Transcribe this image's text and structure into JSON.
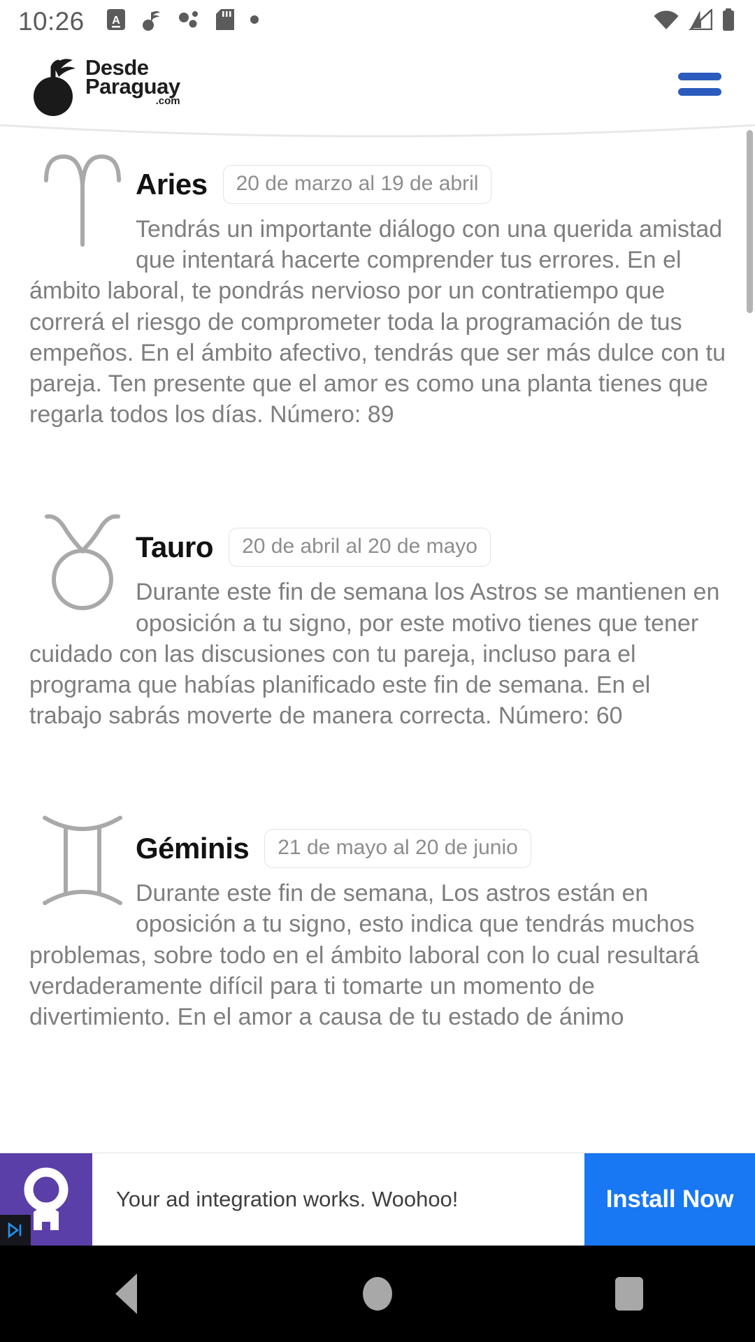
{
  "statusbar": {
    "time": "10:26",
    "left_icons": [
      "caps-lock-a-icon",
      "music-note-icon",
      "bluetooth-dots-icon",
      "sd-card-icon",
      "dot-icon"
    ],
    "right_icons": [
      "wifi-icon",
      "cellular-signal-icon",
      "battery-icon"
    ]
  },
  "header": {
    "logo_line1": "Desde",
    "logo_line2": "Paraguay",
    "logo_line3": ".com",
    "menu_icon": "hamburger-menu-icon",
    "menu_color": "#2a5bbd"
  },
  "signs": [
    {
      "glyph": "aries-ram-icon",
      "name": "Aries",
      "dates": "20 de marzo al 19 de abril",
      "text": "Tendrás un importante diálogo con una querida amistad que intentará hacerte comprender tus errores. En el ámbito laboral, te pondrás nervioso por un contratiempo que correrá el riesgo de comprometer toda la programación de tus empeños. En el ámbito afectivo, tendrás que ser más dulce con tu pareja. Ten presente que el amor es como una planta tienes que regarla todos los días. Número: 89"
    },
    {
      "glyph": "taurus-bull-icon",
      "name": "Tauro",
      "dates": "20 de abril al 20 de mayo",
      "text": "Durante este fin de semana los Astros se mantienen en oposición a tu signo, por este motivo tienes que tener cuidado con las discusiones con tu pareja, incluso para el programa que habías planificado este fin de semana. En el trabajo sabrás moverte de manera correcta. Número: 60"
    },
    {
      "glyph": "gemini-twins-icon",
      "name": "Géminis",
      "dates": "21 de mayo al 20 de junio",
      "text": "Durante este fin de semana, Los astros están en oposición a tu signo, esto indica que tendrás muchos problemas, sobre todo en el ámbito laboral con lo cual resultará verdaderamente difícil para ti tomarte un momento de divertimiento. En el amor a causa de tu estado de ánimo"
    }
  ],
  "ad": {
    "icon": "rocket-astronaut-icon",
    "badge_icon": "ad-choices-icon",
    "text": "Your ad integration works. Woohoo!",
    "cta_label": "Install Now",
    "cta_color": "#1877f2",
    "thumb_color": "#5b3fa8"
  },
  "navbar": {
    "back": "back-triangle-icon",
    "home": "home-circle-icon",
    "recent": "recent-apps-square-icon"
  }
}
